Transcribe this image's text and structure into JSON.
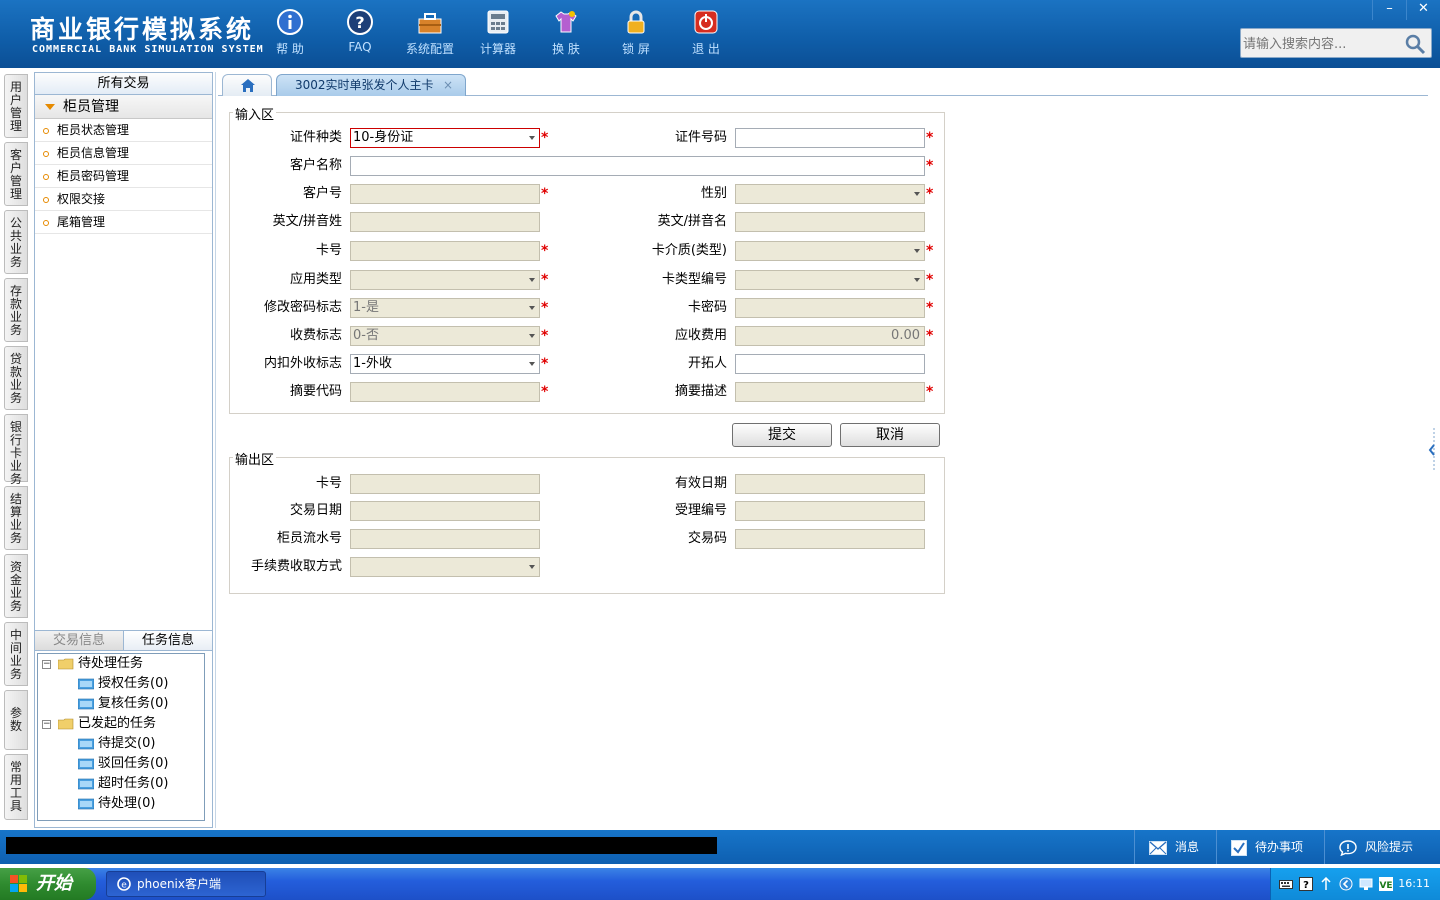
{
  "header": {
    "logo_cn": "商业银行模拟系统",
    "logo_en": "COMMERCIAL BANK SIMULATION SYSTEM",
    "toolbar": [
      {
        "label": "帮 助",
        "icon": "info-icon"
      },
      {
        "label": "FAQ",
        "icon": "question-icon"
      },
      {
        "label": "系统配置",
        "icon": "toolbox-icon"
      },
      {
        "label": "计算器",
        "icon": "calculator-icon"
      },
      {
        "label": "换 肤",
        "icon": "shirt-icon"
      },
      {
        "label": "锁 屏",
        "icon": "lock-icon"
      },
      {
        "label": "退 出",
        "icon": "power-icon"
      }
    ],
    "search_placeholder": "请输入搜索内容...",
    "window_controls": [
      "–",
      "✕"
    ]
  },
  "vtabs": [
    "用户管理",
    "客户管理",
    "公共业务",
    "存款业务",
    "贷款业务",
    "银行卡业务",
    "结算业务",
    "资金业务",
    "中间业务",
    "参数",
    "常用工具"
  ],
  "left_panel": {
    "title": "所有交易",
    "section": "柜员管理",
    "items": [
      "柜员状态管理",
      "柜员信息管理",
      "柜员密码管理",
      "权限交接",
      "尾箱管理"
    ],
    "tabs": [
      "交易信息",
      "任务信息"
    ],
    "tree": {
      "pending": "待处理任务",
      "pending_children": [
        "授权任务(0)",
        "复核任务(0)"
      ],
      "initiated": "已发起的任务",
      "initiated_children": [
        "待提交(0)",
        "驳回任务(0)",
        "超时任务(0)",
        "待处理(0)"
      ]
    }
  },
  "main_tabs": {
    "active_tab": "3002实时单张发个人主卡",
    "close_symbol": "×"
  },
  "form": {
    "input_legend": "输入区",
    "output_legend": "输出区",
    "fields": {
      "id_type": {
        "label": "证件种类",
        "value": "10-身份证"
      },
      "id_number": {
        "label": "证件号码",
        "value": ""
      },
      "customer_name": {
        "label": "客户名称",
        "value": ""
      },
      "customer_no": {
        "label": "客户号",
        "value": ""
      },
      "gender": {
        "label": "性别",
        "value": ""
      },
      "en_surname": {
        "label": "英文/拼音姓",
        "value": ""
      },
      "en_given": {
        "label": "英文/拼音名",
        "value": ""
      },
      "card_no": {
        "label": "卡号",
        "value": ""
      },
      "card_medium": {
        "label": "卡介质(类型)",
        "value": ""
      },
      "app_type": {
        "label": "应用类型",
        "value": ""
      },
      "card_type_no": {
        "label": "卡类型编号",
        "value": ""
      },
      "modify_pwd_flag": {
        "label": "修改密码标志",
        "value": "1-是"
      },
      "card_pwd": {
        "label": "卡密码",
        "value": ""
      },
      "fee_flag": {
        "label": "收费标志",
        "value": "0-否"
      },
      "fee_due": {
        "label": "应收费用",
        "value": "0.00"
      },
      "fee_internal_external": {
        "label": "内扣外收标志",
        "value": "1-外收"
      },
      "developer": {
        "label": "开拓人",
        "value": ""
      },
      "summary_code": {
        "label": "摘要代码",
        "value": ""
      },
      "summary_desc": {
        "label": "摘要描述",
        "value": ""
      }
    },
    "output": {
      "card_no": {
        "label": "卡号",
        "value": ""
      },
      "valid_date": {
        "label": "有效日期",
        "value": ""
      },
      "trade_date": {
        "label": "交易日期",
        "value": ""
      },
      "accept_no": {
        "label": "受理编号",
        "value": ""
      },
      "teller_serial": {
        "label": "柜员流水号",
        "value": ""
      },
      "trade_code": {
        "label": "交易码",
        "value": ""
      },
      "fee_method": {
        "label": "手续费收取方式",
        "value": ""
      }
    },
    "required_mark": "*",
    "submit_label": "提交",
    "cancel_label": "取消"
  },
  "statusbar": {
    "messages": "消息",
    "todo": "待办事项",
    "risk": "风险提示"
  },
  "taskbar": {
    "start": "开始",
    "task": "phoenix客户端",
    "clock": "16:11"
  },
  "colors": {
    "header_blue": "#0f5da8",
    "required_red": "#e00000",
    "disabled_bg": "#ece9d8",
    "accent_orange": "#e68a00"
  }
}
